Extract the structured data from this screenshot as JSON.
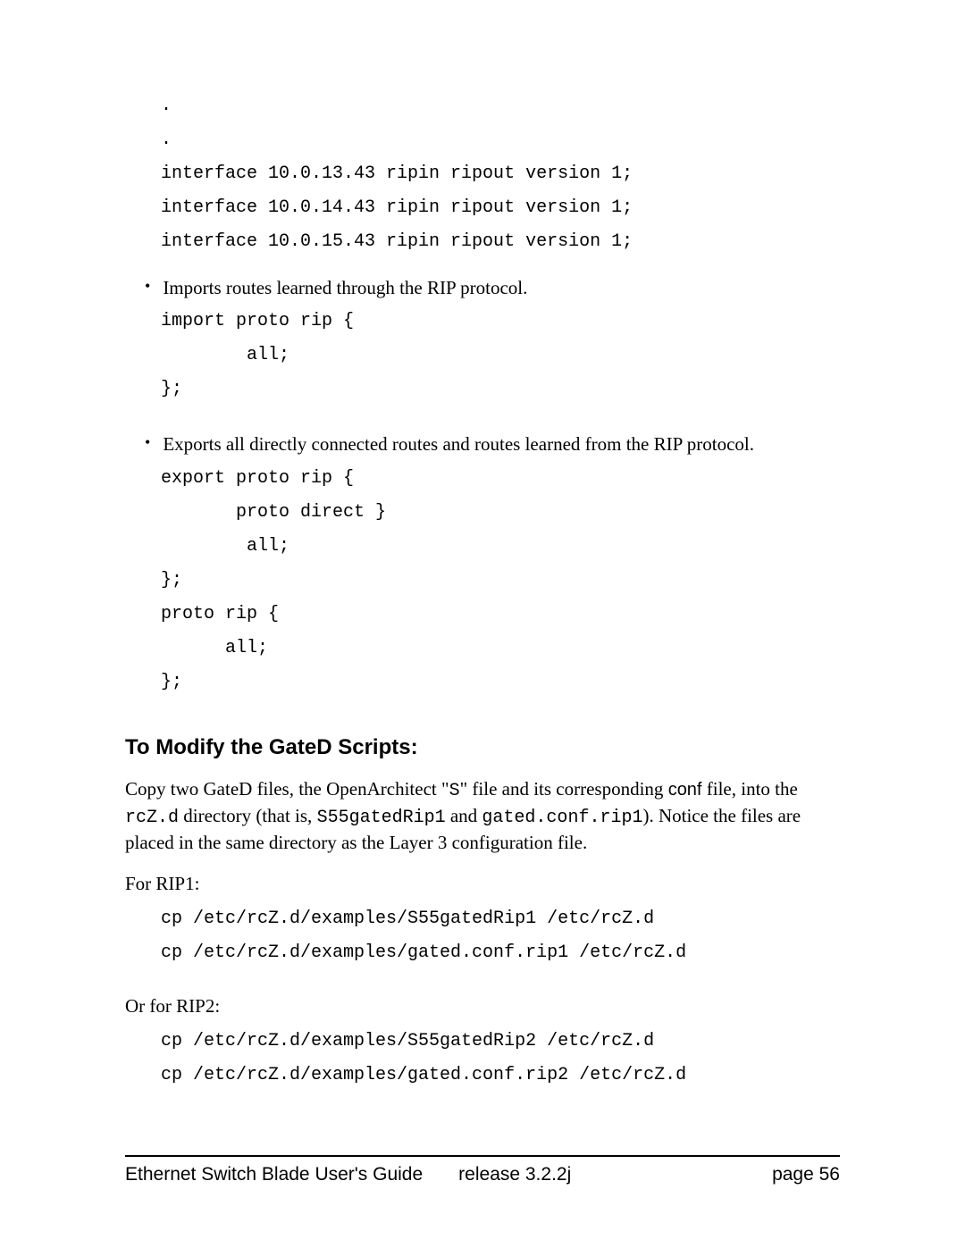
{
  "code_top": ".\n.\ninterface 10.0.13.43 ripin ripout version 1;\ninterface 10.0.14.43 ripin ripout version 1;\ninterface 10.0.15.43 ripin ripout version 1;",
  "bullets": [
    {
      "text": "Imports routes learned through the RIP protocol.",
      "code": "import proto rip {\n        all;\n};"
    },
    {
      "text": "Exports all directly connected routes and routes learned from the RIP protocol.",
      "code": "export proto rip {\n       proto direct }\n        all;\n};\nproto rip {\n      all;\n};"
    }
  ],
  "heading": "To Modify the GateD Scripts:",
  "para": {
    "p1": "Copy two GateD files, the OpenArchitect \"",
    "c1": "S",
    "p2": "\" file and its corresponding ",
    "s1": "conf",
    "p3": " file, into the ",
    "c2": "rcZ.d",
    "p4": " directory (that is, ",
    "c3": "S55gatedRip1",
    "p5": " and ",
    "c4": "gated.conf.rip1",
    "p6": "). Notice the files are placed in the same directory as the Layer 3 configuration file."
  },
  "rip1_label": "For RIP1:",
  "rip1_code": "cp /etc/rcZ.d/examples/S55gatedRip1 /etc/rcZ.d\ncp /etc/rcZ.d/examples/gated.conf.rip1 /etc/rcZ.d",
  "rip2_label": "Or for RIP2:",
  "rip2_code": "cp /etc/rcZ.d/examples/S55gatedRip2 /etc/rcZ.d\ncp /etc/rcZ.d/examples/gated.conf.rip2 /etc/rcZ.d",
  "footer": {
    "title": "Ethernet Switch Blade User's Guide",
    "release": "release  3.2.2j",
    "page": "page 56"
  }
}
